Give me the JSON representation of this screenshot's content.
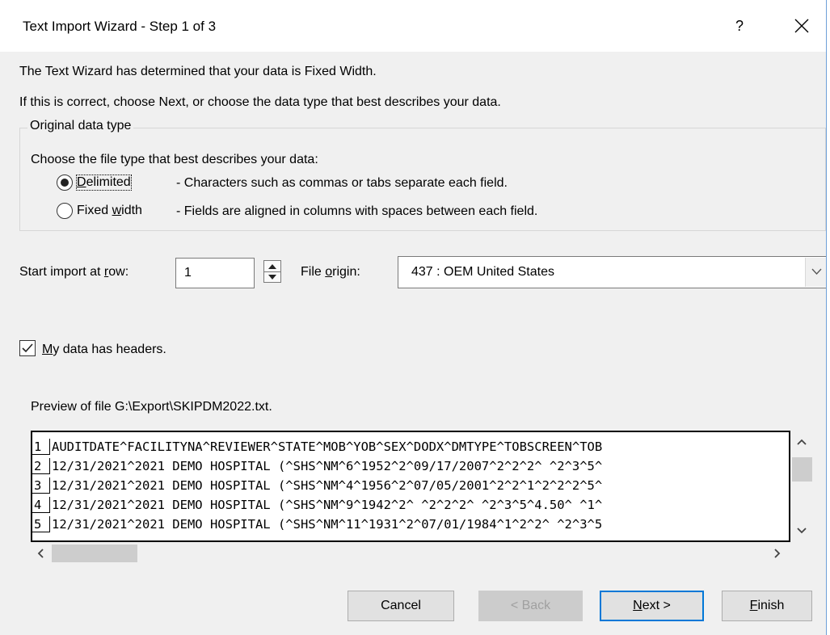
{
  "window": {
    "title": "Text Import Wizard - Step 1 of 3",
    "help_label": "?"
  },
  "intro": {
    "line1": "The Text Wizard has determined that your data is Fixed Width.",
    "line2": "If this is correct, choose Next, or choose the data type that best describes your data."
  },
  "original_data_type": {
    "legend": "Original data type",
    "prompt": "Choose the file type that best describes your data:",
    "options": [
      {
        "label": "Delimited",
        "access_key": "D",
        "description": "- Characters such as commas or tabs separate each field.",
        "selected": true
      },
      {
        "label": "Fixed width",
        "access_key": "w",
        "description": "- Fields are aligned in columns with spaces between each field.",
        "selected": false
      }
    ]
  },
  "start_row": {
    "label": "Start import at row:",
    "value": "1"
  },
  "file_origin": {
    "label": "File origin:",
    "value": "437 : OEM United States"
  },
  "headers_checkbox": {
    "label": "My data has headers.",
    "checked": true
  },
  "preview": {
    "label": "Preview of file G:\\Export\\SKIPDM2022.txt.",
    "rows": [
      {
        "num": "1",
        "text": "AUDITDATE^FACILITYNA^REVIEWER^STATE^MOB^YOB^SEX^DODX^DMTYPE^TOBSCREEN^TOB"
      },
      {
        "num": "2",
        "text": "12/31/2021^2021 DEMO HOSPITAL (^SHS^NM^6^1952^2^09/17/2007^2^2^2^ ^2^3^5^"
      },
      {
        "num": "3",
        "text": "12/31/2021^2021 DEMO HOSPITAL (^SHS^NM^4^1956^2^07/05/2001^2^2^1^2^2^2^5^"
      },
      {
        "num": "4",
        "text": "12/31/2021^2021 DEMO HOSPITAL (^SHS^NM^9^1942^2^ ^2^2^2^ ^2^3^5^4.50^ ^1^"
      },
      {
        "num": "5",
        "text": "12/31/2021^2021 DEMO HOSPITAL (^SHS^NM^11^1931^2^07/01/1984^1^2^2^ ^2^3^5"
      }
    ]
  },
  "buttons": {
    "cancel": "Cancel",
    "back": "< Back",
    "next": "Next >",
    "finish": "Finish"
  }
}
